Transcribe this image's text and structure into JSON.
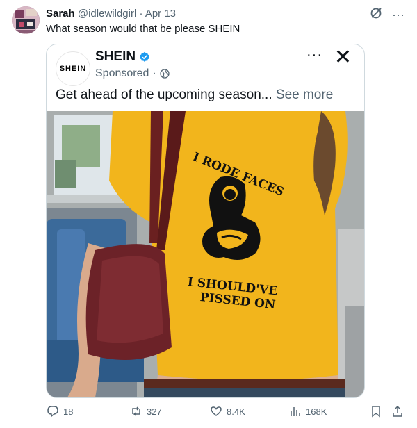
{
  "tweet": {
    "author_name": "Sarah",
    "handle": "@idlewildgirl",
    "separator": "·",
    "date": "Apr 13",
    "text": "What season would that be please SHEIN"
  },
  "icons": {
    "grok": "grok-icon",
    "more": "···"
  },
  "ad": {
    "logo_text": "SHEIN",
    "name": "SHEIN",
    "sponsored_label": "Sponsored",
    "separator": "·",
    "more": "···",
    "close": "✕",
    "copy": "Get ahead of the upcoming season...",
    "see_more": "See more",
    "shirt_print_top": "I RODE FACES",
    "shirt_print_bottom_1": "I SHOULD'VE",
    "shirt_print_bottom_2": "PISSED ON"
  },
  "actions": {
    "replies": "18",
    "reposts": "327",
    "likes": "8.4K",
    "views": "168K"
  },
  "colors": {
    "shirt": "#f2b51c",
    "text_secondary": "#536471",
    "verified": "#1d9bf0"
  }
}
